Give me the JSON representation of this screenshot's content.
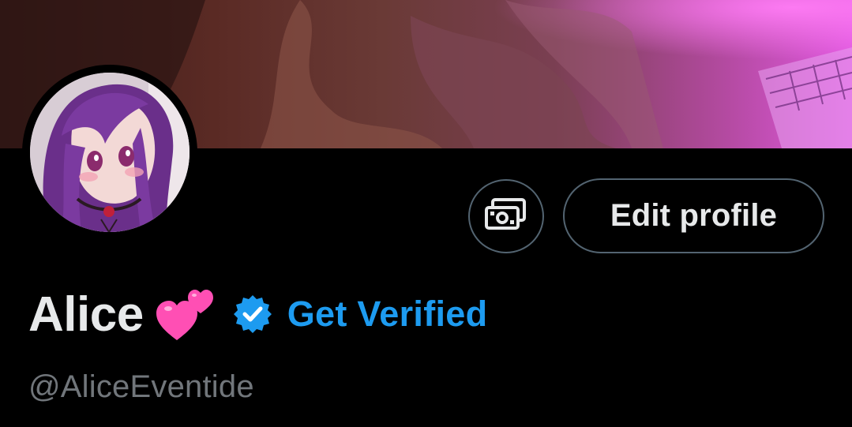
{
  "profile": {
    "display_name": "Alice",
    "name_emoji": "two-hearts-emoji",
    "handle": "@AliceEventide",
    "get_verified_label": "Get Verified",
    "edit_profile_label": "Edit profile"
  },
  "icons": {
    "verified": "verified-badge-icon",
    "money": "money-icon"
  },
  "colors": {
    "background": "#000000",
    "text_primary": "#e7e9ea",
    "text_secondary": "#71767b",
    "accent_blue": "#1d9bf0",
    "button_border": "#536471",
    "heart_pink": "#ff4fb4"
  }
}
